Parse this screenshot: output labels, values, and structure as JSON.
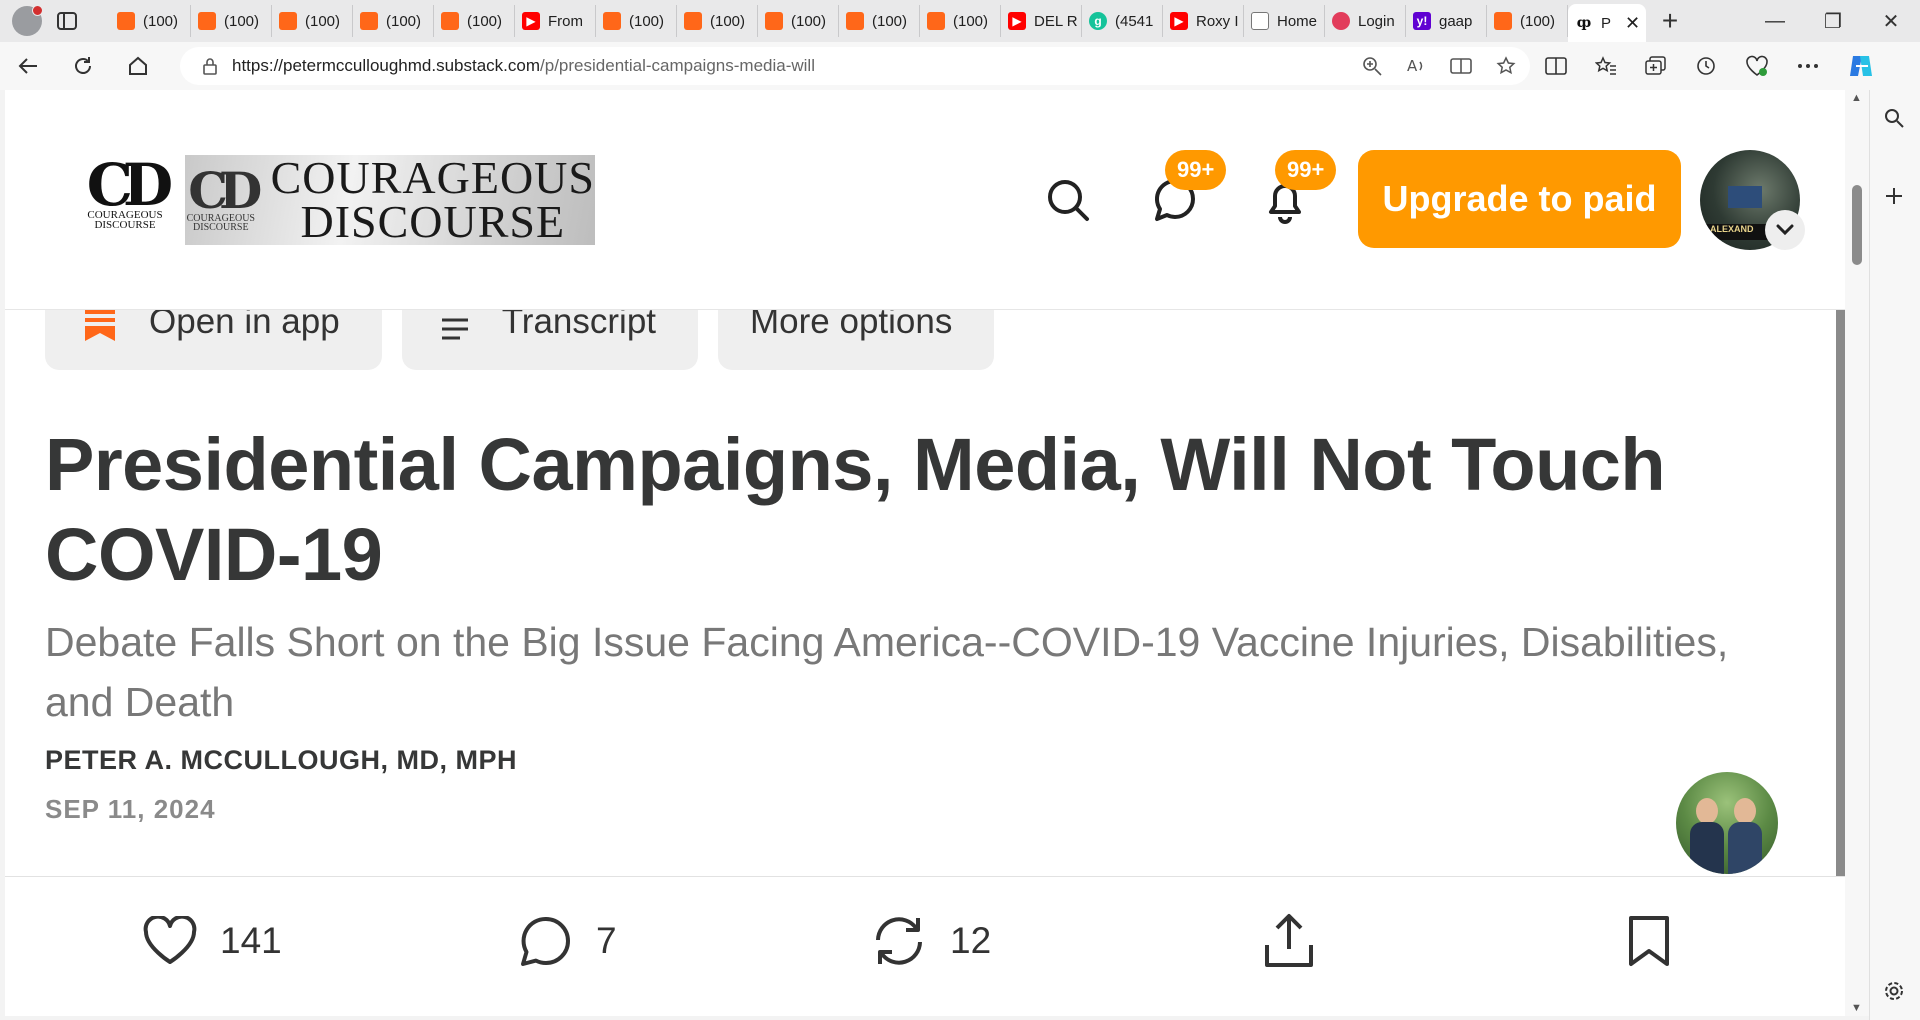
{
  "browser": {
    "tabs": [
      {
        "label": "(100)",
        "favicon": "substack"
      },
      {
        "label": "(100)",
        "favicon": "substack"
      },
      {
        "label": "(100)",
        "favicon": "substack"
      },
      {
        "label": "(100)",
        "favicon": "substack"
      },
      {
        "label": "(100)",
        "favicon": "substack"
      },
      {
        "label": "From",
        "favicon": "youtube"
      },
      {
        "label": "(100)",
        "favicon": "substack"
      },
      {
        "label": "(100)",
        "favicon": "substack"
      },
      {
        "label": "(100)",
        "favicon": "substack"
      },
      {
        "label": "(100)",
        "favicon": "substack"
      },
      {
        "label": "(100)",
        "favicon": "substack"
      },
      {
        "label": "DEL R",
        "favicon": "youtube"
      },
      {
        "label": "(4541",
        "favicon": "grammarly"
      },
      {
        "label": "Roxy I",
        "favicon": "youtube"
      },
      {
        "label": "Home",
        "favicon": "doc"
      },
      {
        "label": "Login",
        "favicon": "login"
      },
      {
        "label": "gaap",
        "favicon": "yahoo"
      },
      {
        "label": "(100)",
        "favicon": "substack"
      }
    ],
    "active_tab": {
      "label": "P",
      "favicon_glyph": "ȹ"
    },
    "url_host": "https://petermcculloughmd.substack.com",
    "url_path": "/p/presidential-campaigns-media-will"
  },
  "header": {
    "logo_sub": "COURAGEOUS DISCOURSE",
    "banner_line1": "COURAGEOUS",
    "banner_line2": "DISCOURSE",
    "chat_badge": "99+",
    "notif_badge": "99+",
    "upgrade_label": "Upgrade to paid",
    "avatar_band": "ALEXAND"
  },
  "actions_row": {
    "open_in_app": "Open in app",
    "transcript": "Transcript",
    "more_options": "More options"
  },
  "post": {
    "title": "Presidential Campaigns, Media, Will Not Touch COVID-19",
    "subtitle": "Debate Falls Short on the Big Issue Facing America--COVID-19 Vaccine Injuries, Disabilities, and Death",
    "author": "PETER A. MCCULLOUGH, MD, MPH",
    "date": "SEP 11, 2024"
  },
  "engagement": {
    "likes": "141",
    "comments": "7",
    "restacks": "12"
  },
  "colors": {
    "accent": "#ff9900",
    "substack": "#ff6719",
    "title_text": "#363737"
  }
}
